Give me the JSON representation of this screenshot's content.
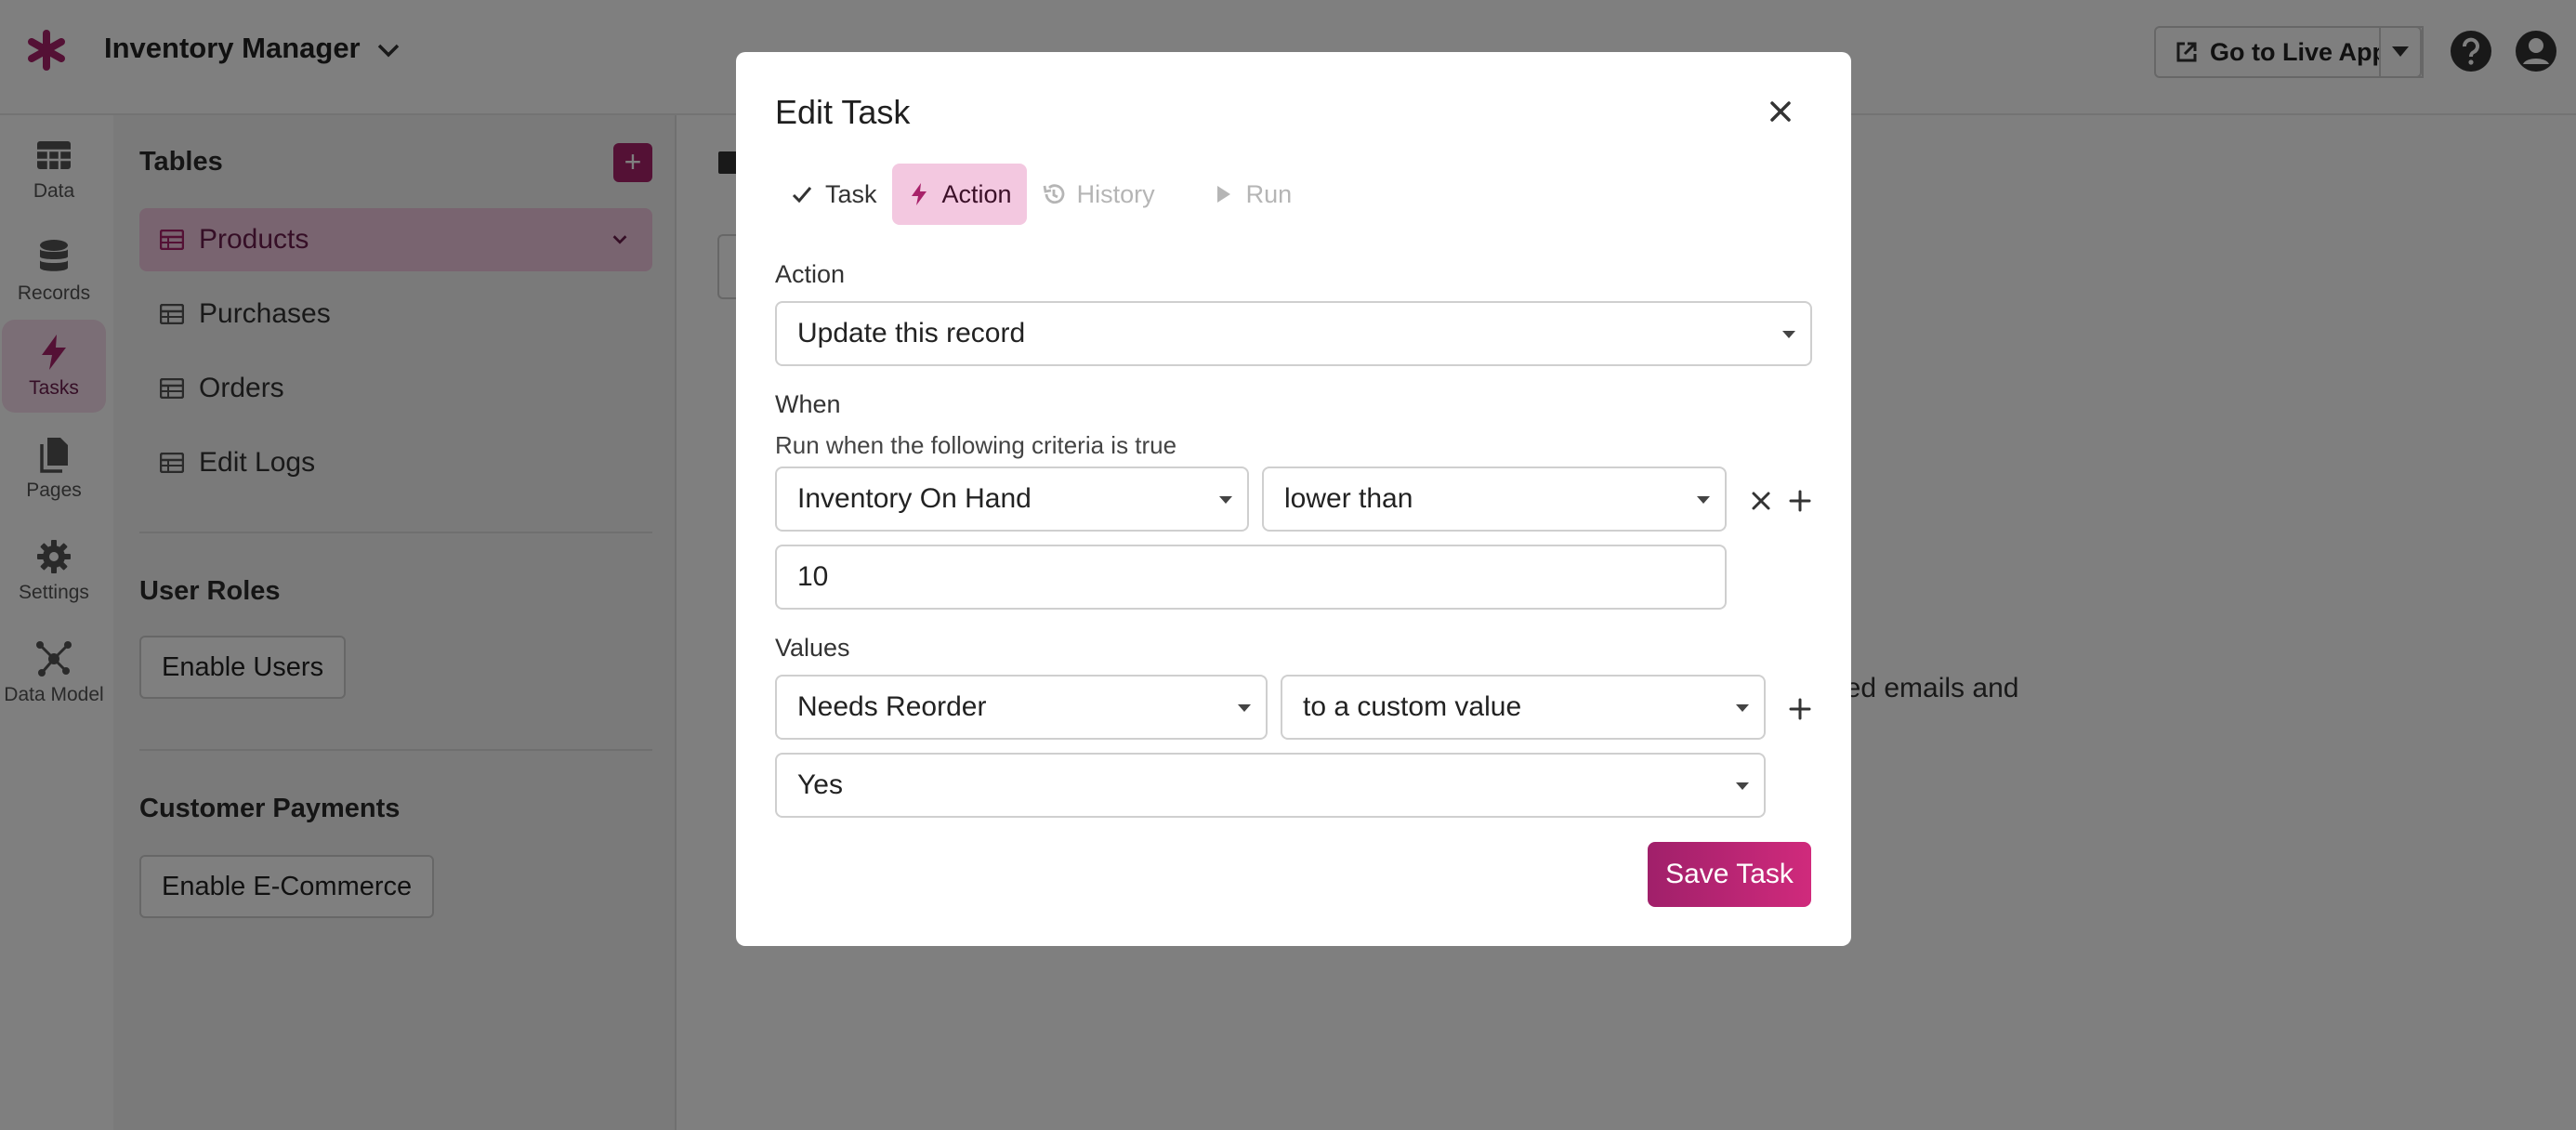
{
  "app": {
    "name": "Inventory Manager",
    "live_app_label": "Go to Live App"
  },
  "railnav": {
    "items": [
      {
        "label": "Data",
        "icon": "table-icon",
        "active": false
      },
      {
        "label": "Records",
        "icon": "database-icon",
        "active": false
      },
      {
        "label": "Tasks",
        "icon": "bolt-icon",
        "active": true
      },
      {
        "label": "Pages",
        "icon": "pages-icon",
        "active": false
      },
      {
        "label": "Settings",
        "icon": "gear-icon",
        "active": false
      },
      {
        "label": "Data Model",
        "icon": "network-icon",
        "active": false
      }
    ]
  },
  "sidebar": {
    "tables_heading": "Tables",
    "add_table_label": "+",
    "tables": [
      {
        "label": "Products",
        "active": true
      },
      {
        "label": "Purchases",
        "active": false
      },
      {
        "label": "Orders",
        "active": false
      },
      {
        "label": "Edit Logs",
        "active": false
      }
    ],
    "user_roles_heading": "User Roles",
    "enable_users_label": "Enable Users",
    "payments_heading": "Customer Payments",
    "enable_ecommerce_label": "Enable E-Commerce"
  },
  "main": {
    "partial_text": "ized emails and"
  },
  "modal": {
    "title": "Edit Task",
    "tabs": [
      {
        "label": "Task",
        "icon": "check-icon",
        "state": "normal"
      },
      {
        "label": "Action",
        "icon": "bolt-icon",
        "state": "active"
      },
      {
        "label": "History",
        "icon": "history-icon",
        "state": "disabled"
      },
      {
        "label": "Run",
        "icon": "play-icon",
        "state": "disabled"
      }
    ],
    "action_label": "Action",
    "action_value": "Update this record",
    "when_label": "When",
    "when_sub": "Run when the following criteria is true",
    "criteria_field": "Inventory On Hand",
    "criteria_operator": "lower than",
    "criteria_value": "10",
    "values_label": "Values",
    "values_field": "Needs Reorder",
    "values_mode": "to a custom value",
    "values_value": "Yes",
    "save_label": "Save Task"
  },
  "colors": {
    "accent": "#a8226a",
    "accent_light": "#f3c8e0",
    "overlay": "rgba(0,0,0,0.5)"
  }
}
